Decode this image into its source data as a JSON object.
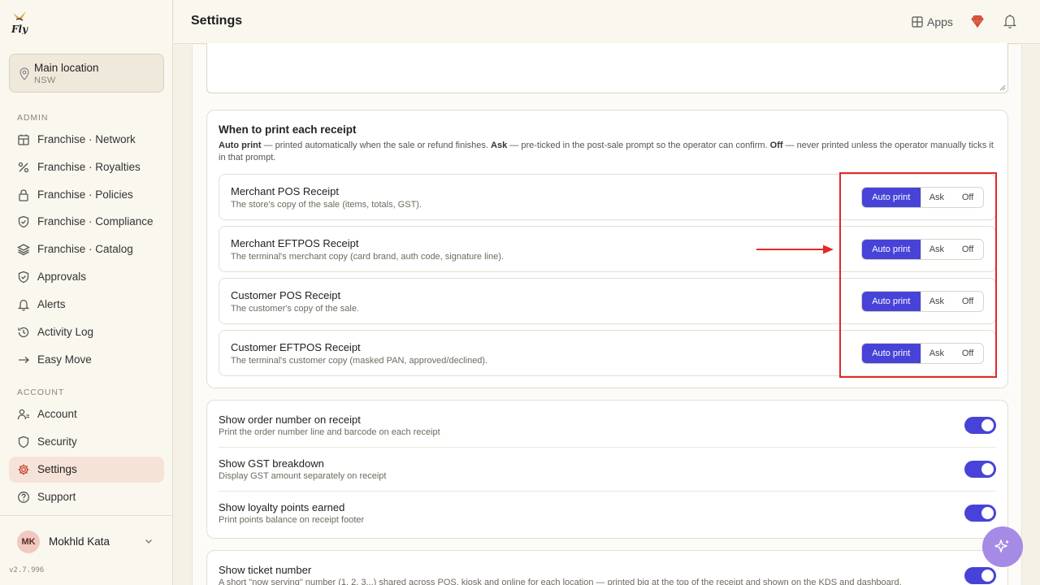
{
  "brand": {
    "logo_text": "Fly"
  },
  "location": {
    "name": "Main location",
    "region": "NSW"
  },
  "sidebar": {
    "admin_label": "ADMIN",
    "admin_items": [
      {
        "label": "Franchise · Network",
        "icon": "network-icon"
      },
      {
        "label": "Franchise · Royalties",
        "icon": "percent-icon"
      },
      {
        "label": "Franchise · Policies",
        "icon": "lock-icon"
      },
      {
        "label": "Franchise · Compliance",
        "icon": "shield-icon"
      },
      {
        "label": "Franchise · Catalog",
        "icon": "layers-icon"
      },
      {
        "label": "Approvals",
        "icon": "shield-check-icon"
      },
      {
        "label": "Alerts",
        "icon": "bell-icon"
      },
      {
        "label": "Activity Log",
        "icon": "history-icon"
      },
      {
        "label": "Easy Move",
        "icon": "arrow-right-icon"
      }
    ],
    "account_label": "ACCOUNT",
    "account_items": [
      {
        "label": "Account",
        "icon": "user-icon"
      },
      {
        "label": "Security",
        "icon": "shield-icon"
      },
      {
        "label": "Settings",
        "icon": "gear-icon",
        "active": true
      },
      {
        "label": "Support",
        "icon": "help-icon"
      }
    ]
  },
  "user": {
    "initials": "MK",
    "name": "Mokhld Kata"
  },
  "version": "v2.7.996",
  "header": {
    "title": "Settings",
    "apps_label": "Apps"
  },
  "print_card": {
    "title": "When to print each receipt",
    "desc_auto_term": "Auto print",
    "desc_auto_text": " — printed automatically when the sale or refund finishes. ",
    "desc_ask_term": "Ask",
    "desc_ask_text": " — pre-ticked in the post-sale prompt so the operator can confirm. ",
    "desc_off_term": "Off",
    "desc_off_text": " — never printed unless the operator manually ticks it in that prompt.",
    "options": [
      "Auto print",
      "Ask",
      "Off"
    ],
    "receipts": [
      {
        "name": "Merchant POS Receipt",
        "desc": "The store's copy of the sale (items, totals, GST).",
        "selected": "Auto print"
      },
      {
        "name": "Merchant EFTPOS Receipt",
        "desc": "The terminal's merchant copy (card brand, auth code, signature line).",
        "selected": "Auto print"
      },
      {
        "name": "Customer POS Receipt",
        "desc": "The customer's copy of the sale.",
        "selected": "Auto print"
      },
      {
        "name": "Customer EFTPOS Receipt",
        "desc": "The terminal's customer copy (masked PAN, approved/declined).",
        "selected": "Auto print"
      }
    ]
  },
  "toggles": [
    {
      "title": "Show order number on receipt",
      "desc": "Print the order number line and barcode on each receipt",
      "on": true
    },
    {
      "title": "Show GST breakdown",
      "desc": "Display GST amount separately on receipt",
      "on": true
    },
    {
      "title": "Show loyalty points earned",
      "desc": "Print points balance on receipt footer",
      "on": true
    }
  ],
  "ticket": {
    "title": "Show ticket number",
    "desc": "A short \"now serving\" number (1, 2, 3...) shared across POS, kiosk and online for each location — printed big at the top of the receipt and shown on the KDS and dashboard.",
    "on": true
  },
  "colors": {
    "accent": "#4743d8",
    "highlight": "#e02a2a",
    "fab": "#a58ae6",
    "active_nav": "#f6e3d8"
  }
}
